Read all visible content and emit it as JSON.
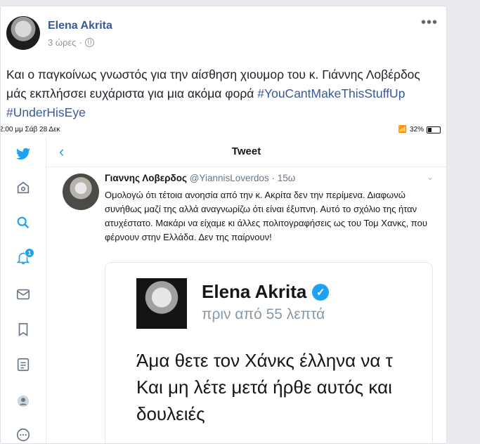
{
  "post": {
    "author": "Elena Akrita",
    "time": "3 ώρες",
    "time_separator": "·",
    "more_label": "•••",
    "text": "Και ο παγκοίνως γνωστός για την αίσθηση χιουμορ του κ. Γιάννης Λοβέρδος μάς εκπλήσσει ευχάριστα για μια ακόμα φορά",
    "hashtags": [
      "#YouCantMakeThisStuffUp",
      "#UnderHisEye"
    ]
  },
  "screenshot": {
    "status_time": "2:00 μμ  Σάβ 28 Δεκ",
    "battery": "32%",
    "header_title": "Tweet",
    "back_label": "‹",
    "notification_count": "1",
    "tweet": {
      "name": "Γιαννης Λοβερδος",
      "handle": "@YiannisLoverdos",
      "time": "· 15ω",
      "chevron": "⌄",
      "body": "Ομολογώ ότι τέτοια ανοησία από την κ. Ακρίτα δεν την περίμενα. Διαφωνώ συνήθως μαζί της αλλά αναγνωρίζω ότι είναι έξυπνη. Αυτό το σχόλιο της ήταν ατυχέστατο. Μακάρι να είχαμε κι άλλες πολιτογραφήσεις ως του Τομ Χανκς, που φέρνουν στην Ελλάδα. Δεν της παίρνουν!"
    },
    "embed": {
      "name": "Elena Akrita",
      "verified": "✓",
      "time": "πριν από 55 λεπτά",
      "lines": [
        "Άμα θετε τον Χάνκς έλληνα να τ",
        "Και μη λέτε μετά ήρθε αυτός και",
        "δουλειές"
      ]
    }
  },
  "icons": [
    "twitter-bird-icon",
    "home-icon",
    "search-icon",
    "notifications-icon",
    "messages-icon",
    "bookmarks-icon",
    "lists-icon",
    "profile-icon",
    "more-icon",
    "globe-icon",
    "wifi-icon",
    "battery-icon",
    "verified-icon"
  ],
  "colors": {
    "link": "#385898",
    "twitter_blue": "#1da1f2",
    "page_bg": "#e9ebee"
  }
}
